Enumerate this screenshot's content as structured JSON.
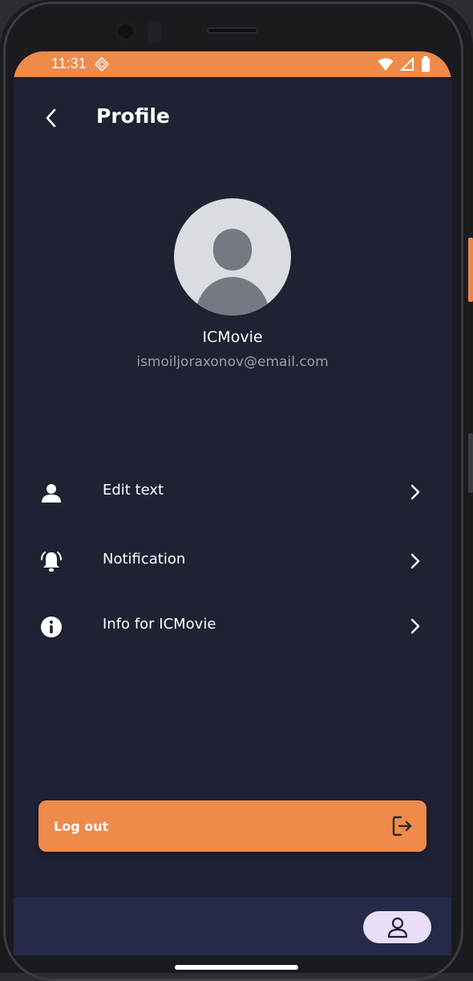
{
  "status_bar": {
    "time": "11:31"
  },
  "header": {
    "title": "Profile",
    "back_icon": "chevron-left-icon"
  },
  "profile": {
    "name": "ICMovie",
    "email": "ismoiljoraxonov@email.com",
    "avatar_icon": "default-avatar-icon"
  },
  "menu": {
    "items": [
      {
        "label": "Edit text",
        "icon": "person-icon"
      },
      {
        "label": "Notification",
        "icon": "bell-ring-icon"
      },
      {
        "label": "Info for ICMovie",
        "icon": "info-icon"
      }
    ]
  },
  "logout": {
    "label": "Log out",
    "icon": "logout-icon"
  },
  "bottom_nav": {
    "active_icon": "person-outline-icon"
  },
  "colors": {
    "accent": "#ee8a4a",
    "background": "#1e2233",
    "bottom_nav": "#252a4a",
    "nav_pill": "#e8def8"
  }
}
